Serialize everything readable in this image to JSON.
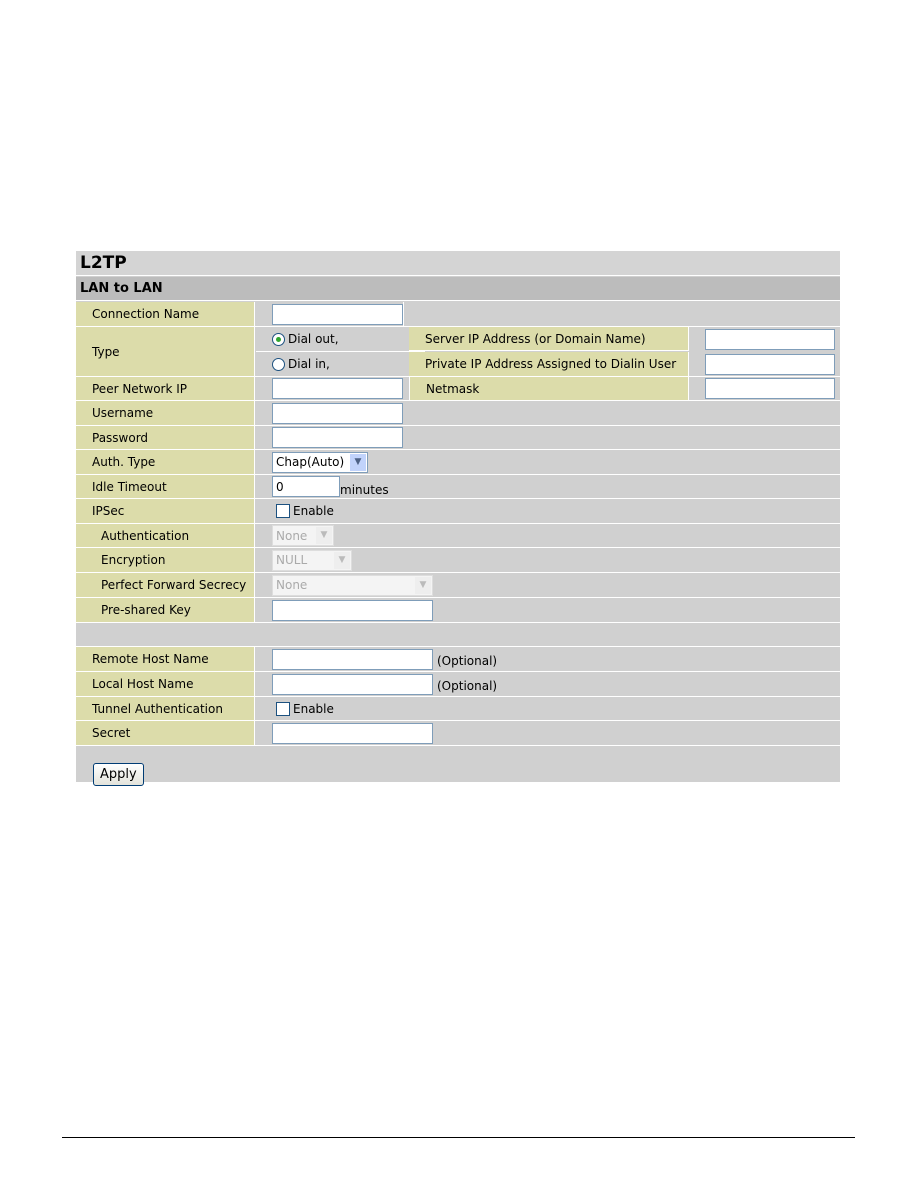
{
  "title": "L2TP",
  "section": "LAN to LAN",
  "fields": {
    "connection_name": {
      "label": "Connection Name",
      "value": ""
    },
    "type": {
      "label": "Type",
      "dial_out": "Dial out,",
      "dial_in": "Dial in,",
      "selected": "Dial out"
    },
    "server_ip": {
      "label": "Server IP Address (or Domain Name)",
      "value": ""
    },
    "private_ip": {
      "label": "Private IP Address Assigned to Dialin User",
      "value": ""
    },
    "peer_network_ip": {
      "label": "Peer Network IP",
      "value": ""
    },
    "netmask": {
      "label": "Netmask",
      "value": ""
    },
    "username": {
      "label": "Username",
      "value": ""
    },
    "password": {
      "label": "Password",
      "value": ""
    },
    "auth_type": {
      "label": "Auth. Type",
      "value": "Chap(Auto)"
    },
    "idle_timeout": {
      "label": "Idle Timeout",
      "value": "0",
      "unit": "minutes"
    },
    "ipsec": {
      "label": "IPSec",
      "checkbox": "Enable",
      "checked": false
    },
    "authentication": {
      "label": "Authentication",
      "value": "None"
    },
    "encryption": {
      "label": "Encryption",
      "value": "NULL"
    },
    "pfs": {
      "label": "Perfect Forward Secrecy",
      "value": "None"
    },
    "psk": {
      "label": "Pre-shared Key",
      "value": ""
    },
    "remote_host": {
      "label": "Remote Host Name",
      "value": "",
      "note": "(Optional)"
    },
    "local_host": {
      "label": "Local Host Name",
      "value": "",
      "note": "(Optional)"
    },
    "tunnel_auth": {
      "label": "Tunnel Authentication",
      "checkbox": "Enable",
      "checked": false
    },
    "secret": {
      "label": "Secret",
      "value": ""
    }
  },
  "apply_label": "Apply",
  "colors": {
    "label_bg": "#dcdcaa",
    "panel_bg": "#d0d0d0"
  }
}
